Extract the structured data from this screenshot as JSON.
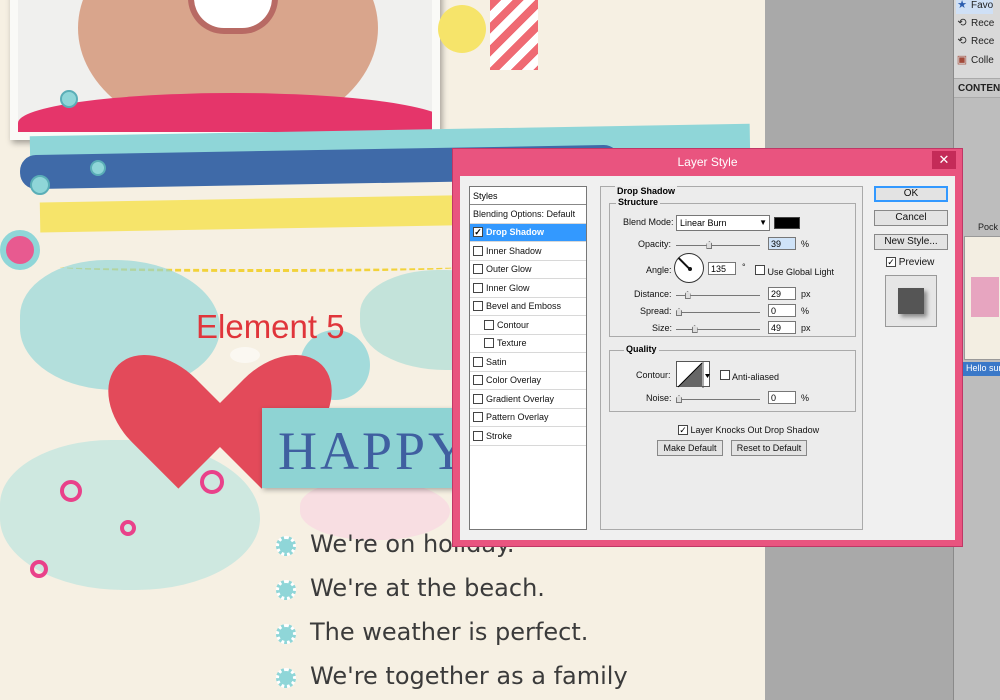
{
  "canvas": {
    "element_label": "Element 5",
    "banner_title": "HAPPY",
    "journal": [
      "We're on holiday.",
      "We're at the beach.",
      "The weather is perfect.",
      "We're together as a family"
    ]
  },
  "right_panel": {
    "items": [
      {
        "label": "Favo",
        "icon": "star-icon",
        "selected": true
      },
      {
        "label": "Rece",
        "icon": "recent-icon",
        "selected": false
      },
      {
        "label": "Rece",
        "icon": "recent-icon",
        "selected": false
      },
      {
        "label": "Colle",
        "icon": "collection-icon",
        "selected": false
      }
    ],
    "section_title": "CONTENT",
    "thumb_label": "Pock",
    "thumb_caption": "Hello sunsh"
  },
  "dialog": {
    "title": "Layer Style",
    "close": "✕",
    "styles_header": "Styles",
    "style_items": [
      {
        "label": "Blending Options: Default",
        "checkbox": false,
        "checked": false,
        "selected": false,
        "indent": false
      },
      {
        "label": "Drop Shadow",
        "checkbox": true,
        "checked": true,
        "selected": true,
        "indent": false
      },
      {
        "label": "Inner Shadow",
        "checkbox": true,
        "checked": false,
        "selected": false,
        "indent": false
      },
      {
        "label": "Outer Glow",
        "checkbox": true,
        "checked": false,
        "selected": false,
        "indent": false
      },
      {
        "label": "Inner Glow",
        "checkbox": true,
        "checked": false,
        "selected": false,
        "indent": false
      },
      {
        "label": "Bevel and Emboss",
        "checkbox": true,
        "checked": false,
        "selected": false,
        "indent": false
      },
      {
        "label": "Contour",
        "checkbox": true,
        "checked": false,
        "selected": false,
        "indent": true
      },
      {
        "label": "Texture",
        "checkbox": true,
        "checked": false,
        "selected": false,
        "indent": true
      },
      {
        "label": "Satin",
        "checkbox": true,
        "checked": false,
        "selected": false,
        "indent": false
      },
      {
        "label": "Color Overlay",
        "checkbox": true,
        "checked": false,
        "selected": false,
        "indent": false
      },
      {
        "label": "Gradient Overlay",
        "checkbox": true,
        "checked": false,
        "selected": false,
        "indent": false
      },
      {
        "label": "Pattern Overlay",
        "checkbox": true,
        "checked": false,
        "selected": false,
        "indent": false
      },
      {
        "label": "Stroke",
        "checkbox": true,
        "checked": false,
        "selected": false,
        "indent": false
      }
    ],
    "section_title": "Drop Shadow",
    "structure": {
      "title": "Structure",
      "blend_mode_label": "Blend Mode:",
      "blend_mode_value": "Linear Burn",
      "shadow_color": "#000000",
      "opacity_label": "Opacity:",
      "opacity_value": "39",
      "opacity_level": 0.39,
      "angle_label": "Angle:",
      "angle_value": "135",
      "degree_symbol": "°",
      "global_light_label": "Use Global Light",
      "global_light_checked": false,
      "distance_label": "Distance:",
      "distance_value": "29",
      "distance_level": 0.11,
      "spread_label": "Spread:",
      "spread_value": "0",
      "spread_level": 0.0,
      "size_label": "Size:",
      "size_value": "49",
      "size_level": 0.2,
      "unit_percent": "%",
      "unit_px": "px"
    },
    "quality": {
      "title": "Quality",
      "contour_label": "Contour:",
      "anti_aliased_label": "Anti-aliased",
      "anti_aliased_checked": false,
      "noise_label": "Noise:",
      "noise_value": "0",
      "noise_level": 0.0,
      "unit_percent": "%"
    },
    "knockout_label": "Layer Knocks Out Drop Shadow",
    "knockout_checked": true,
    "make_default": "Make Default",
    "reset_default": "Reset to Default",
    "ok": "OK",
    "cancel": "Cancel",
    "new_style": "New Style...",
    "preview_label": "Preview",
    "preview_checked": true
  },
  "colors": {
    "dialog_frame": "#e9547f",
    "selection": "#3399ff",
    "element_label": "#e0353b",
    "banner": "#8ed3d3",
    "banner_text": "#3f5fa0"
  }
}
